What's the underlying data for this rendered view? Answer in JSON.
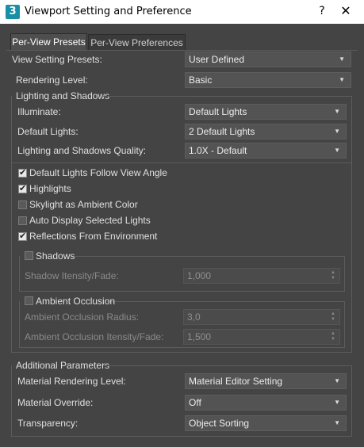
{
  "window": {
    "title": "Viewport Setting and Preference",
    "app_icon": "3",
    "help": "?",
    "close": "✕"
  },
  "tabs": [
    {
      "label": "Per-View Presets"
    },
    {
      "label": "Per-View Preferences"
    }
  ],
  "presets": {
    "label": "View Setting Presets:",
    "value": "User Defined"
  },
  "rendering": {
    "label": "Rendering Level:",
    "value": "Basic"
  },
  "lighting": {
    "group_label": "Lighting and Shadows",
    "illuminate": {
      "label": "Illuminate:",
      "value": "Default Lights"
    },
    "default_lights": {
      "label": "Default Lights:",
      "value": "2 Default Lights"
    },
    "quality": {
      "label": "Lighting and Shadows Quality:",
      "value": "1.0X - Default"
    },
    "checks": [
      {
        "label": "Default Lights Follow View Angle",
        "checked": true
      },
      {
        "label": "Highlights",
        "checked": true
      },
      {
        "label": "Skylight as Ambient Color",
        "checked": false
      },
      {
        "label": "Auto Display Selected Lights",
        "checked": false
      },
      {
        "label": "Reflections From Environment",
        "checked": true
      }
    ],
    "shadows": {
      "label": "Shadows",
      "checked": false,
      "fade": {
        "label": "Shadow Itensity/Fade:",
        "value": "1,000"
      }
    },
    "ao": {
      "label": "Ambient Occlusion",
      "checked": false,
      "radius": {
        "label": "Ambient Occlusion Radius:",
        "value": "3,0"
      },
      "fade": {
        "label": "Ambient Occlusion Itensity/Fade:",
        "value": "1,500"
      }
    }
  },
  "additional": {
    "group_label": "Additional Parameters",
    "material_rendering": {
      "label": "Material Rendering Level:",
      "value": "Material Editor Setting"
    },
    "material_override": {
      "label": "Material Override:",
      "value": "Off"
    },
    "transparency": {
      "label": "Transparency:",
      "value": "Object Sorting"
    }
  },
  "icons": {
    "dropdown": "▼",
    "spin_up": "▲",
    "spin_down": "▼"
  }
}
